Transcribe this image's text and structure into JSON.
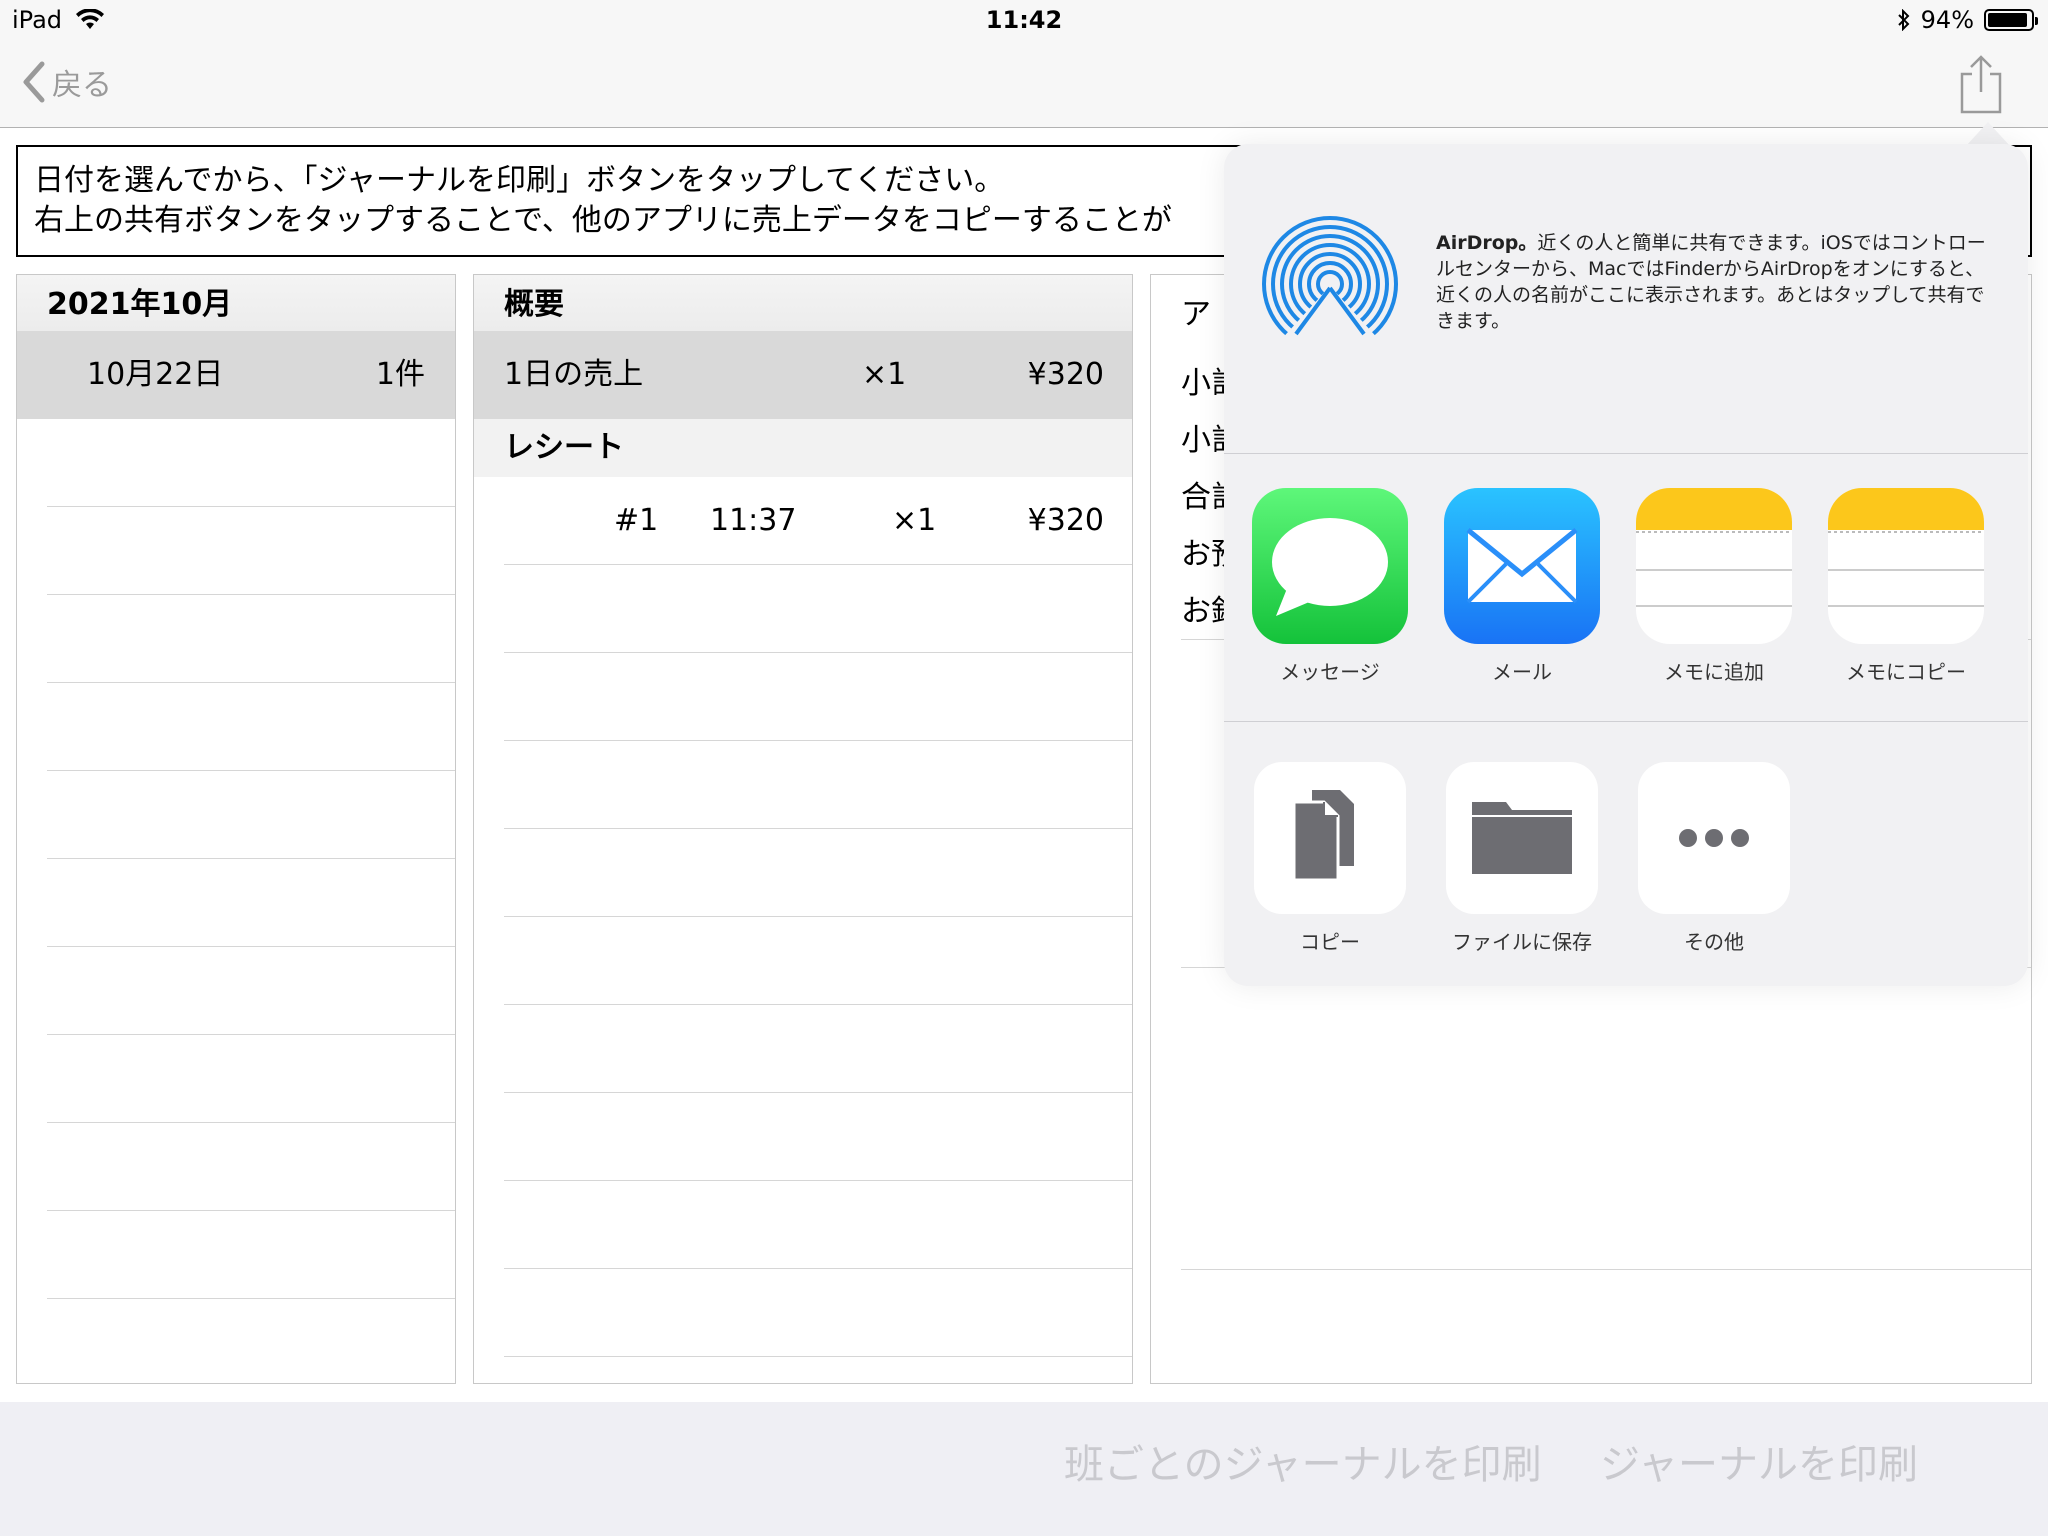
{
  "status_bar": {
    "device": "iPad",
    "time": "11:42",
    "battery": "94%",
    "battery_level": 0.94
  },
  "nav": {
    "back_label": "戻る"
  },
  "instruction": {
    "line1": "日付を選んでから、「ジャーナルを印刷」ボタンをタップしてください。",
    "line2": "右上の共有ボタンをタップすることで、他のアプリに売上データをコピーすることが"
  },
  "calendar": {
    "header": "2021年10月",
    "selected_date": "10月22日",
    "selected_count": "1件"
  },
  "summary": {
    "header": "概要",
    "daily_label": "1日の売上",
    "daily_qty": "×1",
    "daily_amount": "¥320",
    "receipt_header": "レシート",
    "receipts": [
      {
        "no": "#1",
        "time": "11:37",
        "qty": "×1",
        "amount": "¥320"
      }
    ]
  },
  "detail": {
    "rows": [
      "ア",
      "小計",
      "小計",
      "合計",
      "お預",
      "お釣"
    ]
  },
  "share_sheet": {
    "airdrop_title": "AirDrop。",
    "airdrop_desc": "近くの人と簡単に共有できます。iOSではコントロールセンターから、MacではFinderからAirDropをオンにすると、近くの人の名前がここに表示されます。あとはタップして共有できます。",
    "apps": [
      {
        "label": "メッセージ",
        "icon": "messages-icon"
      },
      {
        "label": "メール",
        "icon": "mail-icon"
      },
      {
        "label": "メモに追加",
        "icon": "notes-icon"
      },
      {
        "label": "メモにコピー",
        "icon": "notes-icon"
      }
    ],
    "actions": [
      {
        "label": "コピー",
        "icon": "copy-icon"
      },
      {
        "label": "ファイルに保存",
        "icon": "folder-icon"
      },
      {
        "label": "その他",
        "icon": "more-icon"
      }
    ]
  },
  "bottom": {
    "print_by_group": "班ごとのジャーナルを印刷",
    "print_journal": "ジャーナルを印刷"
  }
}
